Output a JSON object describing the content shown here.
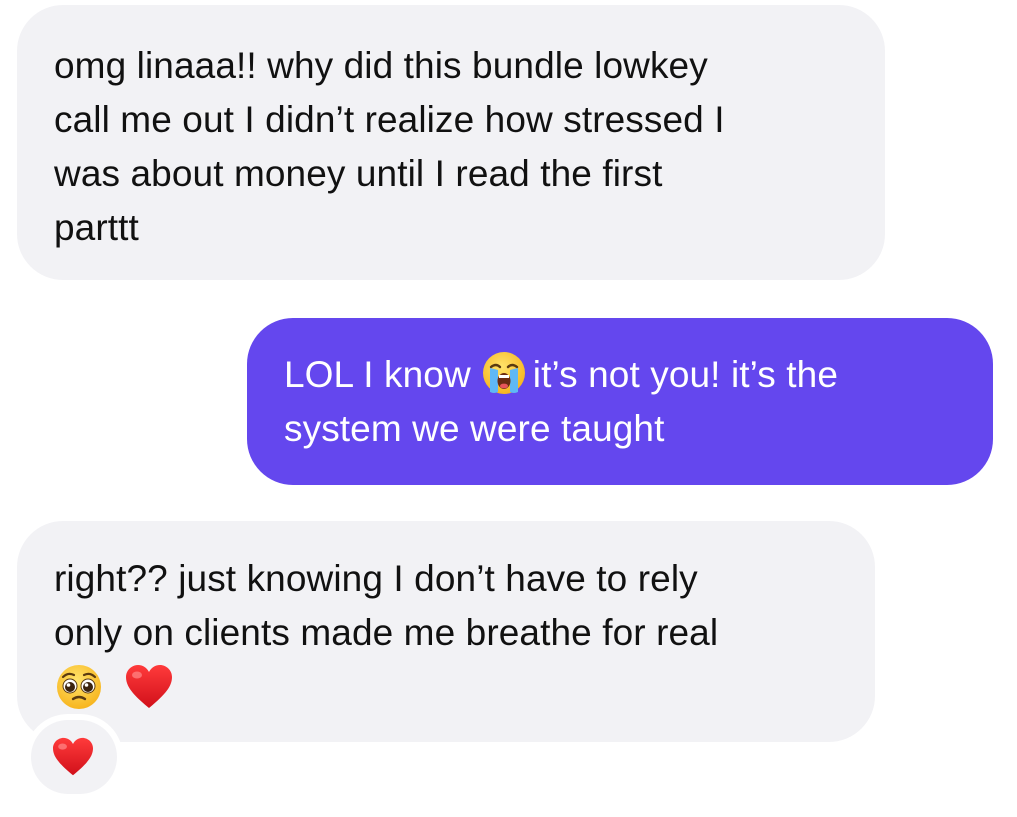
{
  "messages": [
    {
      "direction": "incoming",
      "lines": [
        "omg linaaa!! why did this bundle lowkey",
        "call me out I didn’t realize how stressed I",
        "was about money until I read the first",
        "parttt"
      ]
    },
    {
      "direction": "outgoing",
      "line1_before_emoji": "LOL I know",
      "emoji": "loudly-crying-face",
      "line1_after_emoji": "it’s not you! it’s the",
      "line2": "system we were taught"
    },
    {
      "direction": "incoming",
      "lines": [
        "right?? just knowing I don’t have to rely",
        "only on clients made me breathe for real"
      ],
      "trailing_emojis": [
        "pleading-face",
        "red-heart"
      ],
      "reaction": "red-heart"
    }
  ],
  "colors": {
    "incoming_bubble": "#f2f2f5",
    "outgoing_bubble": "#6447ee",
    "incoming_text": "#111111",
    "outgoing_text": "#ffffff"
  }
}
